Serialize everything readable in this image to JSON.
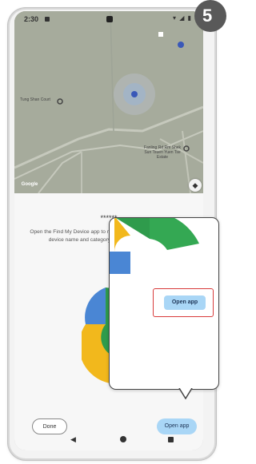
{
  "step_badge": "5",
  "statusbar": {
    "time": "2:30",
    "icons": "▾ ◢ ▮"
  },
  "map": {
    "labels": [
      "Tung Shan Court",
      "Fanling Rd Rm Shek Sun Tsuen Yuen Tse Estate",
      "Google"
    ]
  },
  "sheet": {
    "title": "******",
    "description": "Open the Find My Device app to manage ******.You can change the device name and category, and share it with others.",
    "done_label": "Done",
    "open_app_label": "Open app"
  },
  "callout": {
    "open_app_label": "Open app",
    "highlight_color": "#d83a3a"
  },
  "colors": {
    "button_blue": "#a9d6f6",
    "badge": "#595959"
  },
  "icons": [
    "back-icon",
    "home-icon",
    "recents-icon",
    "compass-icon",
    "location-pin-icon"
  ]
}
